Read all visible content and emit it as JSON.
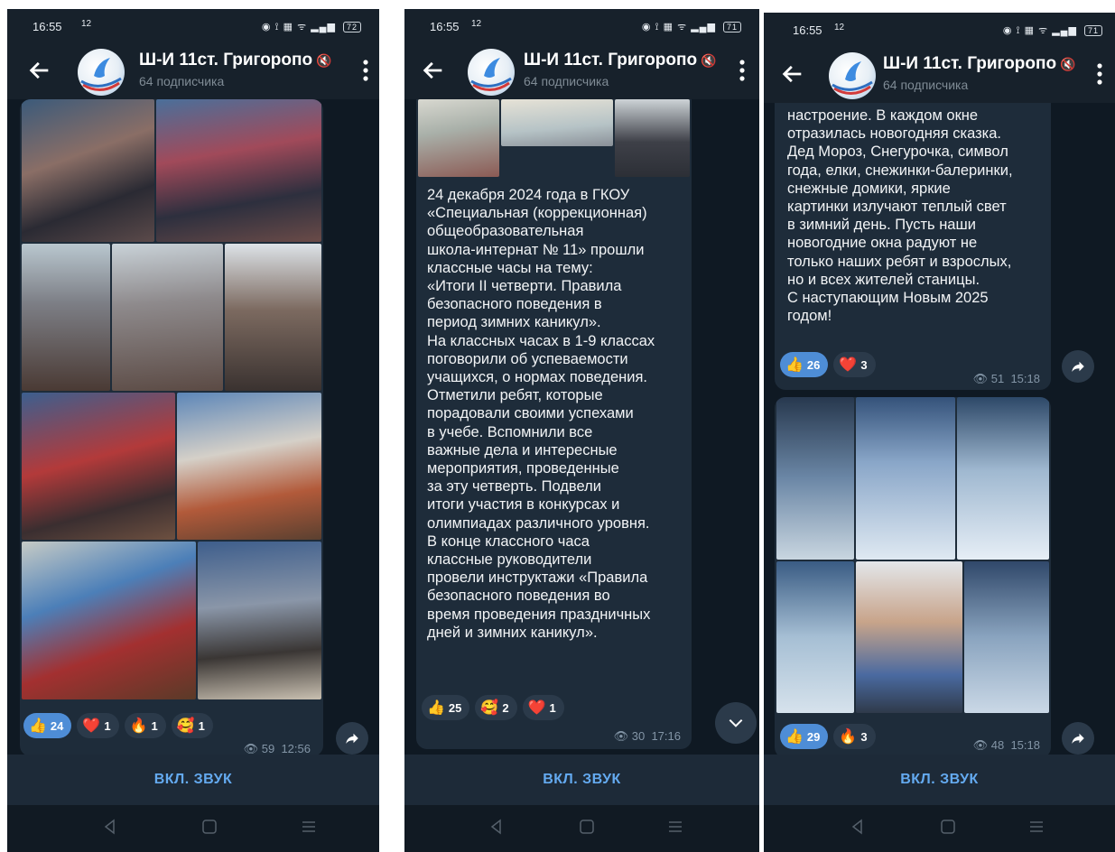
{
  "channel": {
    "name": "Ш-И 11ст. Григоропо",
    "subscribers": "64 подписчика"
  },
  "bottom_button": "ВКЛ. ЗВУК",
  "screens": [
    {
      "time": "16:55",
      "temp": "12",
      "battery": "72",
      "post": {
        "reactions": [
          {
            "emoji": "👍",
            "count": "24",
            "active": true
          },
          {
            "emoji": "❤️",
            "count": "1",
            "active": false
          },
          {
            "emoji": "🔥",
            "count": "1",
            "active": false
          },
          {
            "emoji": "🥰",
            "count": "1",
            "active": false
          }
        ],
        "views": "59",
        "time": "12:56"
      }
    },
    {
      "time": "16:55",
      "temp": "12",
      "battery": "71",
      "post": {
        "text": "24 декабря 2024 года в ГКОУ\n«Специальная (коррекционная)\nобщеобразовательная\nшкола-интернат № 11» прошли\nклассные часы на тему:\n«Итоги II четверти. Правила\nбезопасного поведения в\nпериод зимних каникул».\nНа классных часах в 1-9 классах\nпоговорили об успеваемости\nучащихся, о нормах поведения.\nОтметили ребят, которые\nпорадовали своими успехами\nв учебе. Вспомнили все\nважные дела и интересные\nмероприятия, проведенные\nза эту четверть. Подвели\nитоги участия в конкурсах и\nолимпиадах различного уровня.\nВ конце классного часа\nклассные руководители\nпровели инструктажи «Правила\nбезопасного поведения во\nвремя проведения праздничных\nдней и зимних каникул».",
        "reactions": [
          {
            "emoji": "👍",
            "count": "25",
            "active": false
          },
          {
            "emoji": "🥰",
            "count": "2",
            "active": false
          },
          {
            "emoji": "❤️",
            "count": "1",
            "active": false
          }
        ],
        "views": "30",
        "time": "17:16"
      }
    },
    {
      "time": "16:55",
      "temp": "12",
      "battery": "71",
      "post_text": {
        "text": "настроение. В каждом окне\nотразилась новогодняя сказка.\nДед Мороз, Снегурочка, символ\nгода, елки, снежинки-балеринки,\nснежные домики, яркие\nкартинки излучают теплый свет\nв зимний день. Пусть наши\nновогодние окна радуют не\nтолько наших ребят и взрослых,\nно и всех жителей станицы.\nС наступающим Новым 2025\nгодом!",
        "reactions": [
          {
            "emoji": "👍",
            "count": "26",
            "active": true
          },
          {
            "emoji": "❤️",
            "count": "3",
            "active": false
          }
        ],
        "views": "51",
        "time": "15:18"
      },
      "post_photos": {
        "reactions": [
          {
            "emoji": "👍",
            "count": "29",
            "active": true
          },
          {
            "emoji": "🔥",
            "count": "3",
            "active": false
          }
        ],
        "views": "48",
        "time": "15:18"
      }
    }
  ],
  "colors": {
    "background": "#17212b",
    "bubble": "#1e2c3a",
    "accent": "#64aaf0",
    "active_chip": "#4e8dd6"
  }
}
